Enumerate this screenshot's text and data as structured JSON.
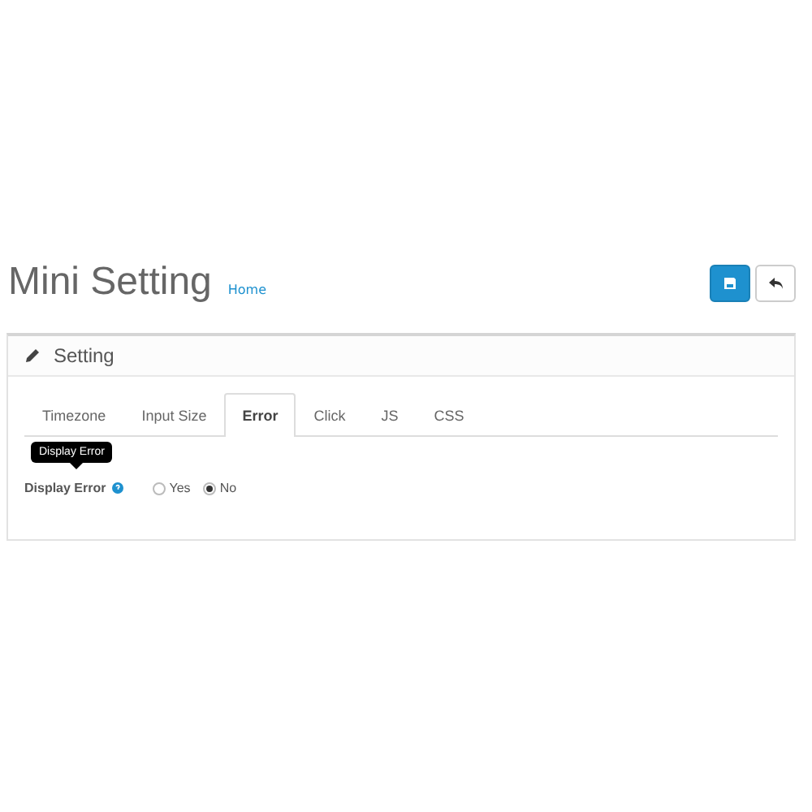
{
  "header": {
    "title": "Mini Setting",
    "breadcrumb": "Home"
  },
  "panel": {
    "title": "Setting"
  },
  "tabs": [
    {
      "label": "Timezone",
      "selected": false
    },
    {
      "label": "Input Size",
      "selected": false
    },
    {
      "label": "Error",
      "selected": true
    },
    {
      "label": "Click",
      "selected": false
    },
    {
      "label": "JS",
      "selected": false
    },
    {
      "label": "CSS",
      "selected": false
    }
  ],
  "field": {
    "label": "Display Error",
    "tooltip": "Display Error",
    "options": [
      {
        "label": "Yes",
        "selected": false
      },
      {
        "label": "No",
        "selected": true
      }
    ]
  }
}
